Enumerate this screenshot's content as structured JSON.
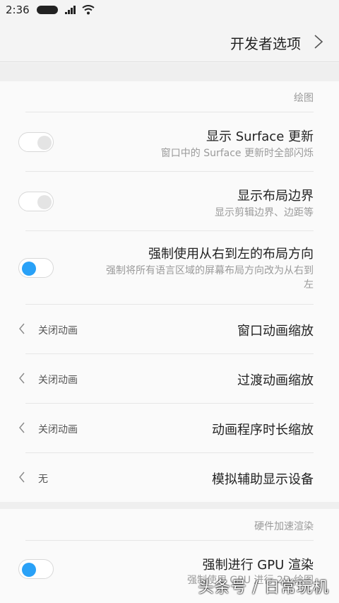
{
  "status_bar": {
    "time": "2:36"
  },
  "header": {
    "title": "开发者选项"
  },
  "drawing_section": {
    "label": "绘图",
    "rows": [
      {
        "title": "显示 Surface 更新",
        "subtitle": "窗口中的 Surface 更新时全部闪烁",
        "toggle": "off"
      },
      {
        "title": "显示布局边界",
        "subtitle": "显示剪辑边界、边距等",
        "toggle": "off"
      },
      {
        "title": "强制使用从右到左的布局方向",
        "subtitle_line1": "强制将所有语言区域的屏幕布局方向改为从右到",
        "subtitle_line2": "左",
        "toggle": "on"
      }
    ],
    "picker_rows": [
      {
        "title": "窗口动画缩放",
        "value": "关闭动画"
      },
      {
        "title": "过渡动画缩放",
        "value": "关闭动画"
      },
      {
        "title": "动画程序时长缩放",
        "value": "关闭动画"
      },
      {
        "title": "模拟辅助显示设备",
        "value": "无"
      }
    ]
  },
  "hardware_section": {
    "label": "硬件加速渲染",
    "rows": [
      {
        "title": "强制进行 GPU 渲染",
        "subtitle": "强制使用 GPU 进行 2D 绘图",
        "toggle": "on"
      }
    ]
  },
  "watermark": "头条号 / 日常玩机",
  "colors": {
    "accent": "#29a1f7"
  }
}
